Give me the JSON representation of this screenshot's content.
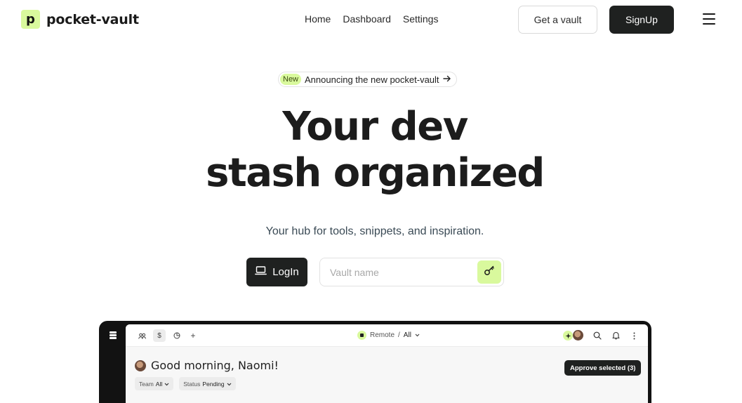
{
  "brand": {
    "mark": "p",
    "name": "pocket-vault",
    "accent": "#d9f99d",
    "dark": "#1f2120"
  },
  "nav": {
    "links": [
      "Home",
      "Dashboard",
      "Settings"
    ],
    "get_vault": "Get a vault",
    "signup": "SignUp"
  },
  "hero": {
    "badge": "New",
    "announcement": "Announcing the new pocket-vault",
    "title_line1": "Your dev",
    "title_line2": "stash organized",
    "subtitle": "Your hub for tools, snippets, and inspiration.",
    "login_label": "LogIn",
    "vault_placeholder": "Vault name"
  },
  "preview": {
    "breadcrumb": {
      "workspace": "Remote",
      "separator": "/",
      "scope": "All"
    },
    "greeting": "Good morning, Naomi!",
    "filters": [
      {
        "label": "Team",
        "value": "All"
      },
      {
        "label": "Status",
        "value": "Pending"
      }
    ],
    "approve_button": "Approve selected (3)"
  }
}
